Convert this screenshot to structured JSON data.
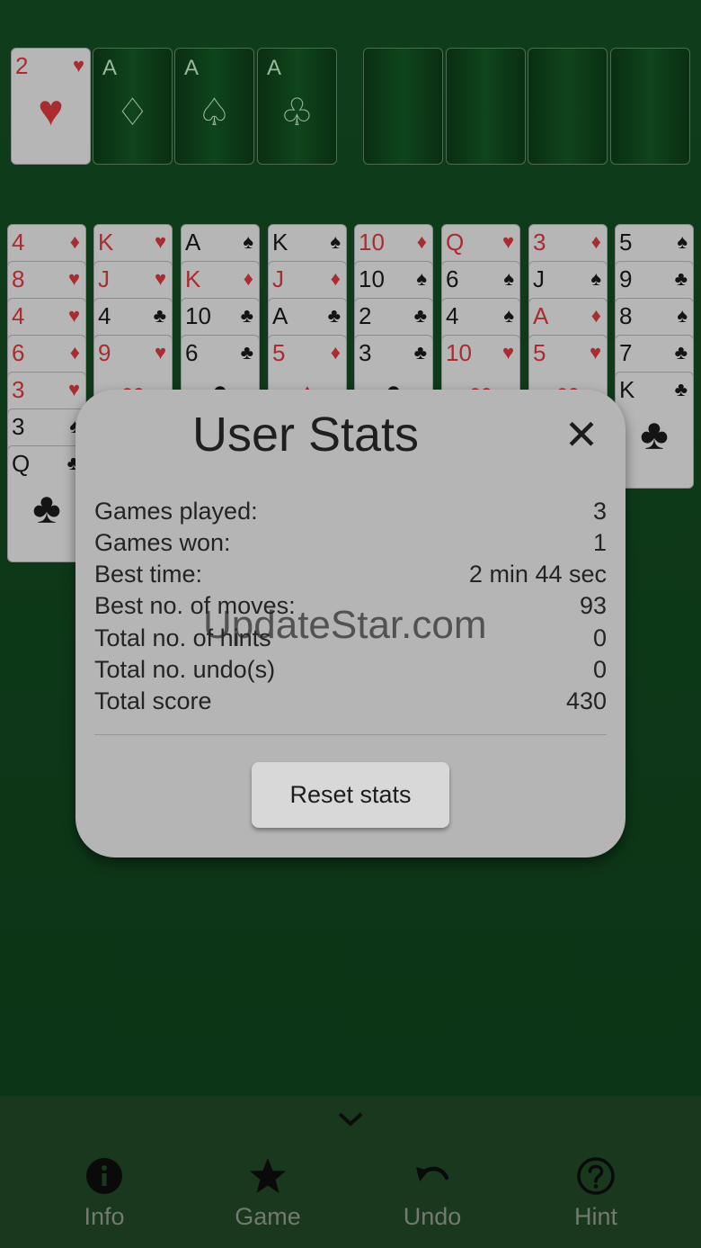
{
  "foundations": [
    {
      "rank": "2",
      "suit": "♥",
      "color": "red",
      "filled": true
    },
    {
      "rank": "A",
      "suit": "♢"
    },
    {
      "rank": "A",
      "suit": "♤"
    },
    {
      "rank": "A",
      "suit": "♧"
    }
  ],
  "tableau": [
    [
      {
        "rank": "4",
        "suit": "♦",
        "color": "red"
      },
      {
        "rank": "8",
        "suit": "♥",
        "color": "red"
      },
      {
        "rank": "4",
        "suit": "♥",
        "color": "red"
      },
      {
        "rank": "6",
        "suit": "♦",
        "color": "red"
      },
      {
        "rank": "3",
        "suit": "♥",
        "color": "red"
      },
      {
        "rank": "3",
        "suit": "♠",
        "color": "black"
      },
      {
        "rank": "Q",
        "suit": "♣",
        "color": "black"
      }
    ],
    [
      {
        "rank": "K",
        "suit": "♥",
        "color": "red"
      },
      {
        "rank": "J",
        "suit": "♥",
        "color": "red"
      },
      {
        "rank": "4",
        "suit": "♣",
        "color": "black"
      },
      {
        "rank": "9",
        "suit": "♥",
        "color": "red"
      }
    ],
    [
      {
        "rank": "A",
        "suit": "♠",
        "color": "black"
      },
      {
        "rank": "K",
        "suit": "♦",
        "color": "red"
      },
      {
        "rank": "10",
        "suit": "♣",
        "color": "black"
      },
      {
        "rank": "6",
        "suit": "♣",
        "color": "black"
      }
    ],
    [
      {
        "rank": "K",
        "suit": "♠",
        "color": "black"
      },
      {
        "rank": "J",
        "suit": "♦",
        "color": "red"
      },
      {
        "rank": "A",
        "suit": "♣",
        "color": "black"
      },
      {
        "rank": "5",
        "suit": "♦",
        "color": "red"
      }
    ],
    [
      {
        "rank": "10",
        "suit": "♦",
        "color": "red"
      },
      {
        "rank": "10",
        "suit": "♠",
        "color": "black"
      },
      {
        "rank": "2",
        "suit": "♣",
        "color": "black"
      },
      {
        "rank": "3",
        "suit": "♣",
        "color": "black"
      }
    ],
    [
      {
        "rank": "Q",
        "suit": "♥",
        "color": "red"
      },
      {
        "rank": "6",
        "suit": "♠",
        "color": "black"
      },
      {
        "rank": "4",
        "suit": "♠",
        "color": "black"
      },
      {
        "rank": "10",
        "suit": "♥",
        "color": "red"
      }
    ],
    [
      {
        "rank": "3",
        "suit": "♦",
        "color": "red"
      },
      {
        "rank": "J",
        "suit": "♠",
        "color": "black"
      },
      {
        "rank": "A",
        "suit": "♦",
        "color": "red"
      },
      {
        "rank": "5",
        "suit": "♥",
        "color": "red"
      }
    ],
    [
      {
        "rank": "5",
        "suit": "♠",
        "color": "black"
      },
      {
        "rank": "9",
        "suit": "♣",
        "color": "black"
      },
      {
        "rank": "8",
        "suit": "♠",
        "color": "black"
      },
      {
        "rank": "7",
        "suit": "♣",
        "color": "black"
      },
      {
        "rank": "K",
        "suit": "♣",
        "color": "black"
      }
    ]
  ],
  "dialog": {
    "title": "User Stats",
    "close_icon": "close-icon",
    "stats": [
      {
        "label": "Games played:",
        "value": "3"
      },
      {
        "label": "Games won:",
        "value": "1"
      },
      {
        "label": "Best time:",
        "value": "2 min 44 sec"
      },
      {
        "label": "Best no. of moves:",
        "value": "93"
      },
      {
        "label": "Total no. of hints",
        "value": "0"
      },
      {
        "label": "Total no. undo(s)",
        "value": "0"
      },
      {
        "label": "Total score",
        "value": "430"
      }
    ],
    "reset_label": "Reset stats"
  },
  "watermark": "UpdateStar.com",
  "nav": {
    "info": "Info",
    "game": "Game",
    "undo": "Undo",
    "hint": "Hint"
  },
  "colors": {
    "table": "#0e3a1a",
    "red_suit": "#a82c30",
    "dialog_bg": "#b5b5b5"
  }
}
